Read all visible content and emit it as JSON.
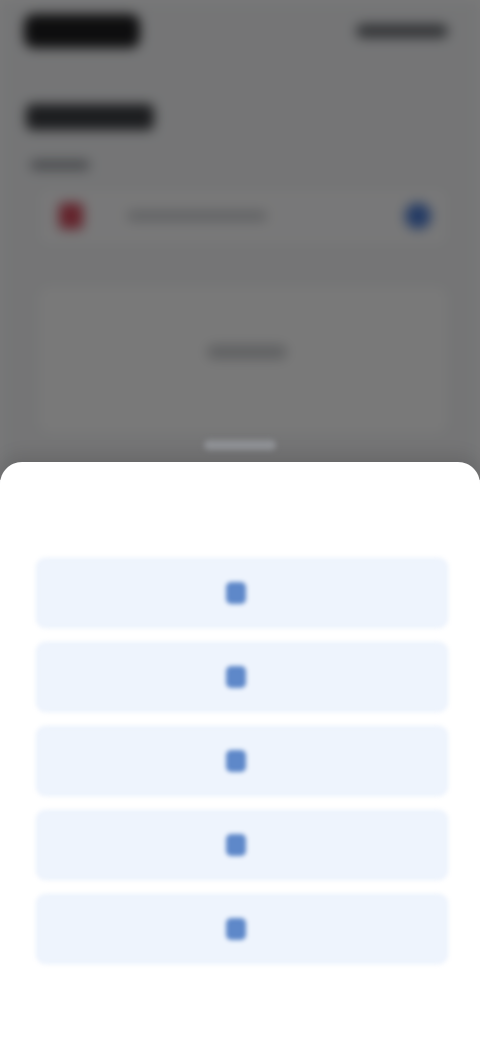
{
  "background_app": {
    "logo": "logo",
    "top_link": "",
    "heading": "",
    "field_label": "",
    "field_value": "",
    "card_text": ""
  },
  "sheet": {
    "title": "",
    "options": [
      {
        "icon": "option-icon",
        "label": ""
      },
      {
        "icon": "option-icon",
        "label": ""
      },
      {
        "icon": "option-icon",
        "label": ""
      },
      {
        "icon": "option-icon",
        "label": ""
      },
      {
        "icon": "option-icon",
        "label": ""
      }
    ]
  },
  "colors": {
    "overlay": "#000000",
    "option_background": "#eef4fd",
    "option_text": "#4a76bb",
    "accent_red": "#d04a5b",
    "accent_blue": "#4a7ad1"
  }
}
